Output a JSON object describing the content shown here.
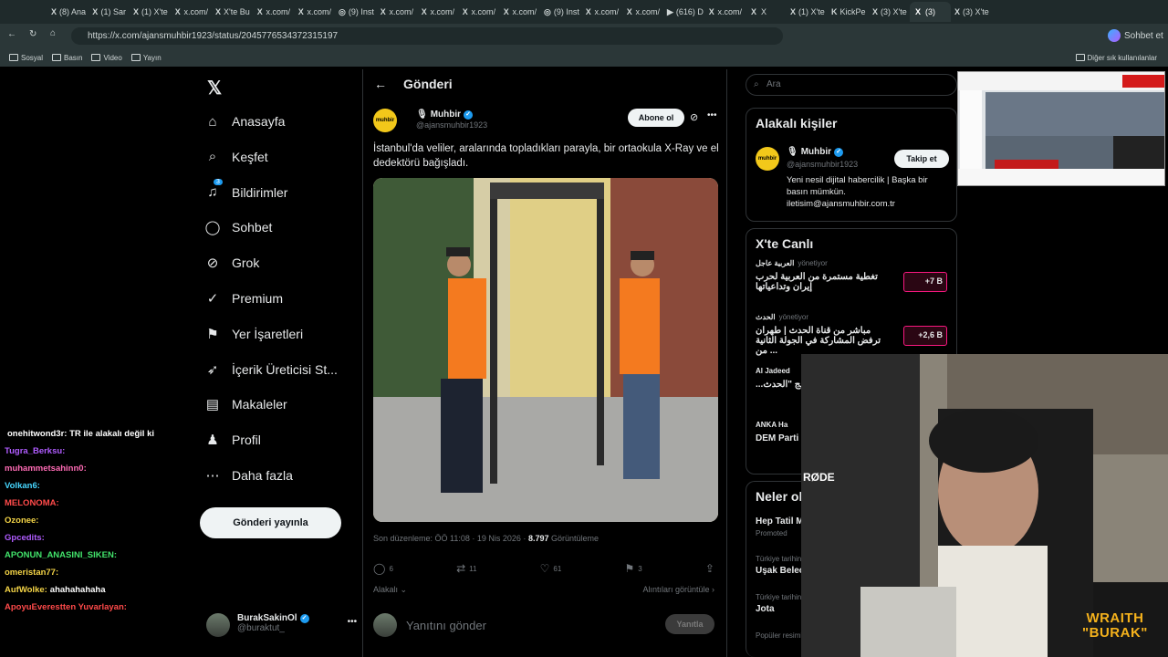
{
  "browser": {
    "tabs": [
      {
        "icon": "X",
        "label": "(8) Ana"
      },
      {
        "icon": "X",
        "label": "(1) Sar"
      },
      {
        "icon": "X",
        "label": "(1) X'te"
      },
      {
        "icon": "X",
        "label": "x.com/"
      },
      {
        "icon": "X",
        "label": "X'te Bu"
      },
      {
        "icon": "X",
        "label": "x.com/"
      },
      {
        "icon": "X",
        "label": "x.com/"
      },
      {
        "icon": "◎",
        "label": "(9) Inst"
      },
      {
        "icon": "X",
        "label": "x.com/"
      },
      {
        "icon": "X",
        "label": "x.com/"
      },
      {
        "icon": "X",
        "label": "x.com/"
      },
      {
        "icon": "X",
        "label": "x.com/"
      },
      {
        "icon": "◎",
        "label": "(9) Inst"
      },
      {
        "icon": "X",
        "label": "x.com/"
      },
      {
        "icon": "X",
        "label": "x.com/"
      },
      {
        "icon": "▶",
        "label": "(616) D"
      },
      {
        "icon": "X",
        "label": "x.com/"
      },
      {
        "icon": "X",
        "label": "X"
      },
      {
        "icon": "X",
        "label": "(1) X'te"
      },
      {
        "icon": "K",
        "label": "KickPe"
      },
      {
        "icon": "X",
        "label": "(3) X'te"
      },
      {
        "icon": "X",
        "label": "(3)"
      },
      {
        "icon": "X",
        "label": "(3) X'te"
      }
    ],
    "url": "https://x.com/ajansmuhbir1923/status/2045776534372315197",
    "chat_button": "Sohbet et",
    "bookmarks": [
      "Sosyal",
      "Basın",
      "Video",
      "Yayın"
    ],
    "other_bookmarks": "Diğer sık kullanılanlar"
  },
  "nav": {
    "items": [
      {
        "icon": "⌂",
        "label": "Anasayfa"
      },
      {
        "icon": "⌕",
        "label": "Keşfet"
      },
      {
        "icon": "♫",
        "label": "Bildirimler"
      },
      {
        "icon": "◯",
        "label": "Sohbet"
      },
      {
        "icon": "⊘",
        "label": "Grok"
      },
      {
        "icon": "✓",
        "label": "Premium"
      },
      {
        "icon": "⚑",
        "label": "Yer İşaretleri"
      },
      {
        "icon": "➶",
        "label": "İçerik Üreticisi St..."
      },
      {
        "icon": "▤",
        "label": "Makaleler"
      },
      {
        "icon": "♟",
        "label": "Profil"
      },
      {
        "icon": "⋯",
        "label": "Daha fazla"
      }
    ],
    "notif_count": "3",
    "post_button": "Gönderi yayınla",
    "user": {
      "name": "BurakSakinOl",
      "handle": "@buraktut_"
    }
  },
  "post": {
    "header": "Gönderi",
    "author": "Muhbir",
    "handle": "@ajansmuhbir1923",
    "logo": "muhbir",
    "follow_label": "Abone ol",
    "text": "İstanbul'da veliler, aralarında topladıkları parayla, bir ortaokula X-Ray ve el dedektörü bağışladı.",
    "edited": "Son düzenleme: ÖÖ 11:08 · 19 Nis 2026 ·",
    "views": "8.797",
    "views_label": "Görüntüleme",
    "replies": "6",
    "reposts": "11",
    "likes": "61",
    "bookmarks": "3",
    "related": "Alakalı",
    "quotes": "Alıntıları görüntüle",
    "reply_placeholder": "Yanıtını gönder",
    "reply_button": "Yanıtla"
  },
  "sidebar": {
    "search_placeholder": "Ara",
    "related_title": "Alakalı kişiler",
    "related_person": {
      "name": "Muhbir",
      "handle": "@ajansmuhbir1923",
      "follow": "Takip et",
      "bio": "Yeni nesil dijital habercilik | Başka bir basın mümkün. iletisim@ajansmuhbir.com.tr"
    },
    "live_title": "X'te Canlı",
    "live": [
      {
        "source": "العربية عاجل",
        "hosting": "yönetiyor",
        "text": "تغطية مستمرة من العربية لحرب إيران وتداعياتها",
        "count": "+7 B"
      },
      {
        "source": "الحدث",
        "hosting": "yönetiyor",
        "text": "مباشر من قناة الحدث | طهران ترفض المشاركة في الجولة الثانية من ...",
        "count": "+2,6 B"
      },
      {
        "source": "Al Jadeed",
        "hosting": "",
        "text": "...دة من برنامج \"الحدث\"",
        "count": ""
      },
      {
        "source": "ANKA Ha",
        "hosting": "",
        "text": "DEM Parti G... Gülistan K...",
        "count": ""
      }
    ],
    "trends_title": "Neler ol",
    "trends": [
      {
        "context": "",
        "name": "Hep Tatil M",
        "sub": "Promoted"
      },
      {
        "context": "Türkiye tarihinde",
        "name": "Uşak Belec",
        "sub": ""
      },
      {
        "context": "Türkiye tarihinde gündemde",
        "name": "Jota",
        "sub": ""
      },
      {
        "context": "Popüler resimler · Gündemde",
        "name": "",
        "sub": ""
      }
    ]
  },
  "chat": {
    "messages": [
      {
        "user": "",
        "text": "onehitwond3r: TR ile alakalı değil ki",
        "color": "#ffffff"
      },
      {
        "user": "Tugra_Berksu:",
        "text": "",
        "color": "#b05cff"
      },
      {
        "user": "muhammetsahinn0:",
        "text": "",
        "color": "#ff6bb5"
      },
      {
        "user": "Volkan6:",
        "text": "",
        "color": "#47d7ff"
      },
      {
        "user": "MELONOMA:",
        "text": "",
        "color": "#ff4a4a"
      },
      {
        "user": "Ozonee:",
        "text": "",
        "color": "#f5d547"
      },
      {
        "user": "Gpcedits:",
        "text": "",
        "color": "#b05cff"
      },
      {
        "user": "APONUN_ANASINI_SIKEN:",
        "text": "",
        "color": "#42e36b"
      },
      {
        "user": "omeristan77:",
        "text": "",
        "color": "#f5d547"
      },
      {
        "user": "AufWolke:",
        "text": "ahahahahaha",
        "color": "#f5d547"
      },
      {
        "user": "ApoyuEverestten Yuvarlayan:",
        "text": "",
        "color": "#ff4a4a"
      }
    ]
  },
  "overlay": {
    "brand_top": "WRAITH",
    "brand_bottom": "\"BURAK\"",
    "mic": "RØDE"
  },
  "colors": {
    "accent": "#1d9bf0",
    "live": "#f91880",
    "bg": "#000000"
  }
}
